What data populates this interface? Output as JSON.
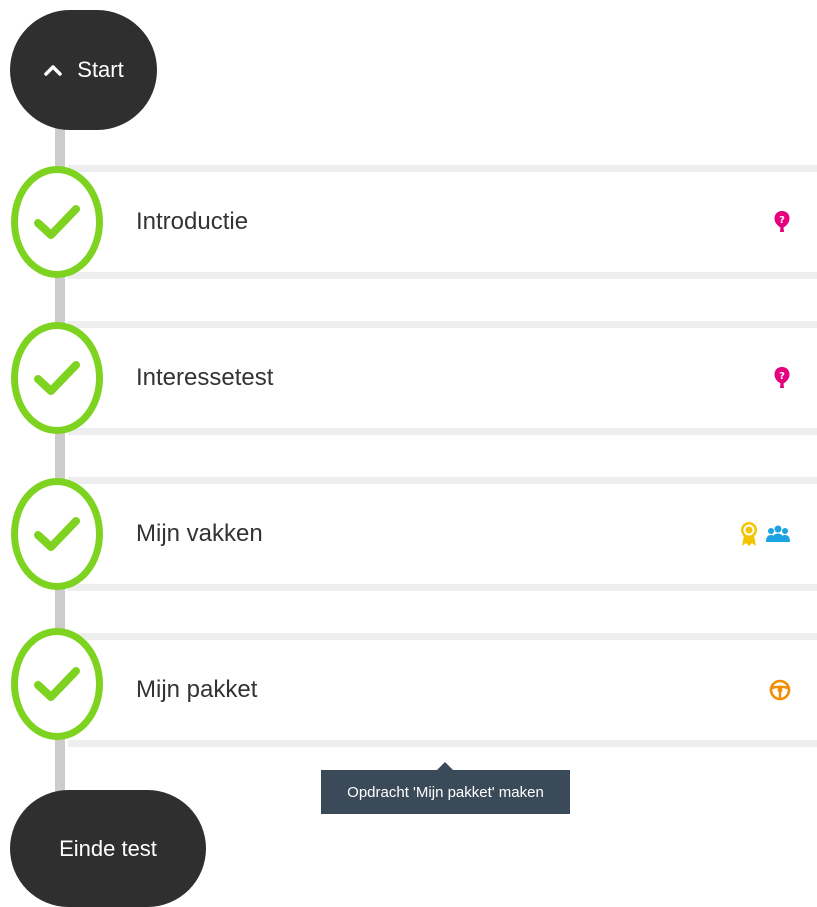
{
  "start": {
    "label": "Start",
    "icon": "chevron-up-icon"
  },
  "end": {
    "label": "Einde test"
  },
  "steps": [
    {
      "label": "Introductie",
      "status": "completed",
      "icons": [
        "question-balloon-icon"
      ]
    },
    {
      "label": "Interessetest",
      "status": "completed",
      "icons": [
        "question-balloon-icon"
      ]
    },
    {
      "label": "Mijn vakken",
      "status": "completed",
      "icons": [
        "award-ribbon-icon",
        "group-icon"
      ]
    },
    {
      "label": "Mijn pakket",
      "status": "completed",
      "icons": [
        "steering-wheel-icon"
      ]
    }
  ],
  "tooltip": {
    "text": "Opdracht 'Mijn pakket' maken"
  },
  "colors": {
    "check_green": "#7ed321",
    "pill_dark": "#2f2f2f",
    "question_pink": "#e6007e",
    "award_yellow": "#f5c400",
    "group_blue": "#1aa3e0",
    "wheel_orange": "#f28c00",
    "tooltip_bg": "#3b4a58"
  }
}
